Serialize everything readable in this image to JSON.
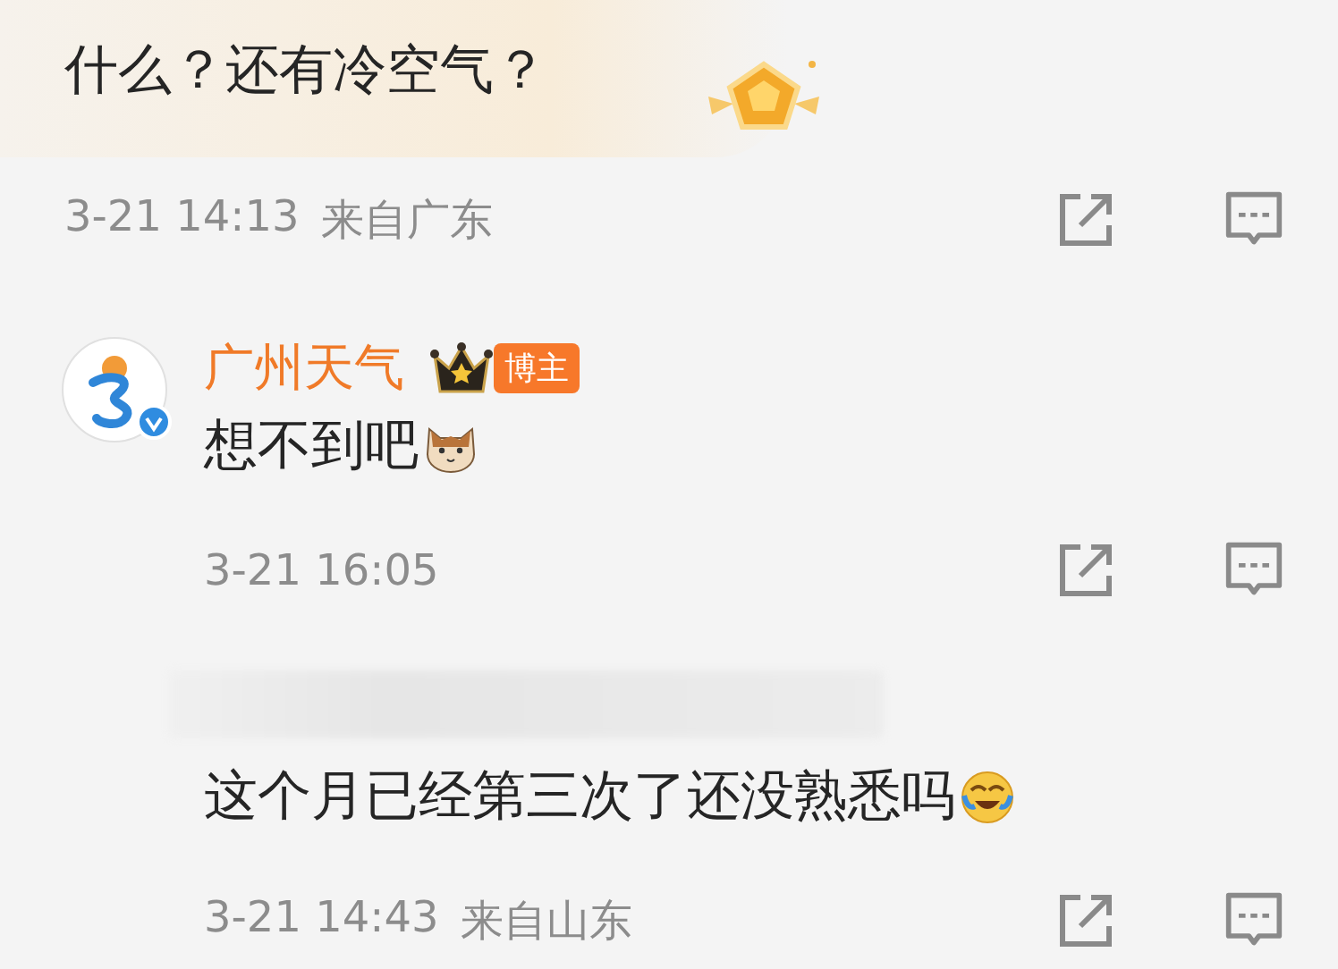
{
  "comments": [
    {
      "kind": "comment",
      "highlighted": true,
      "text": "什么？还有冷空气？",
      "time": "3-21 14:13",
      "location": "来自广东"
    },
    {
      "kind": "reply",
      "author": "广州天气",
      "author_tag": "博主",
      "verified": true,
      "text": "想不到吧",
      "emoji": {
        "kind": "cat"
      },
      "time": "3-21 16:05"
    },
    {
      "kind": "reply",
      "author_redacted": true,
      "text": "这个月已经第三次了还没熟悉吗",
      "emoji": {
        "kind": "laugh-cry"
      },
      "time": "3-21 14:43",
      "location": "来自山东"
    }
  ]
}
